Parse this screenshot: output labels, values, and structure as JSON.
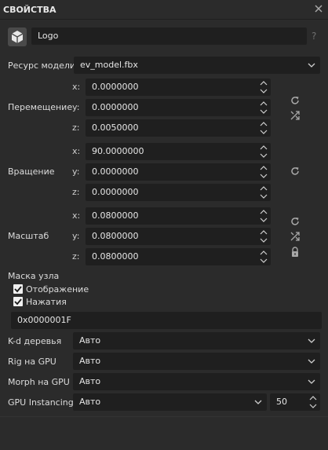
{
  "header": {
    "title": "СВОЙСТВА"
  },
  "object": {
    "name": "Logo",
    "help": "?"
  },
  "model": {
    "label": "Ресурс модели",
    "value": "ev_model.fbx"
  },
  "position": {
    "label": "Перемещение",
    "x_label": "x:",
    "y_label": "y:",
    "z_label": "z:",
    "x": "0.0000000",
    "y": "0.0000000",
    "z": "0.0050000"
  },
  "rotation": {
    "label": "Вращение",
    "x_label": "x:",
    "y_label": "y:",
    "z_label": "z:",
    "x": "90.0000000",
    "y": "0.0000000",
    "z": "0.0000000"
  },
  "scale": {
    "label": "Масштаб",
    "x_label": "x:",
    "y_label": "y:",
    "z_label": "z:",
    "x": "0.0800000",
    "y": "0.0800000",
    "z": "0.0800000"
  },
  "node_mask": {
    "label": "Маска узла",
    "display_label": "Отображение",
    "display_checked": true,
    "clicks_label": "Нажатия",
    "clicks_checked": true,
    "value": "0x0000001F"
  },
  "options": {
    "kd_tree": {
      "label": "K-d деревья",
      "value": "Авто"
    },
    "rig_gpu": {
      "label": "Rig на GPU",
      "value": "Авто"
    },
    "morph_gpu": {
      "label": "Morph на GPU",
      "value": "Авто"
    },
    "gpu_instancing": {
      "label": "GPU Instancing",
      "value": "Авто",
      "count": "50"
    }
  },
  "colors": {
    "background": "#2b2b2b",
    "field": "#1f1f1f",
    "text": "#dcdcdc",
    "icon": "#a8a8a8"
  },
  "icons": [
    "close-icon",
    "cube-icon",
    "reset-icon",
    "shuffle-icon",
    "lock-icon",
    "check-icon",
    "chevron-down-icon",
    "spinner-icon"
  ]
}
